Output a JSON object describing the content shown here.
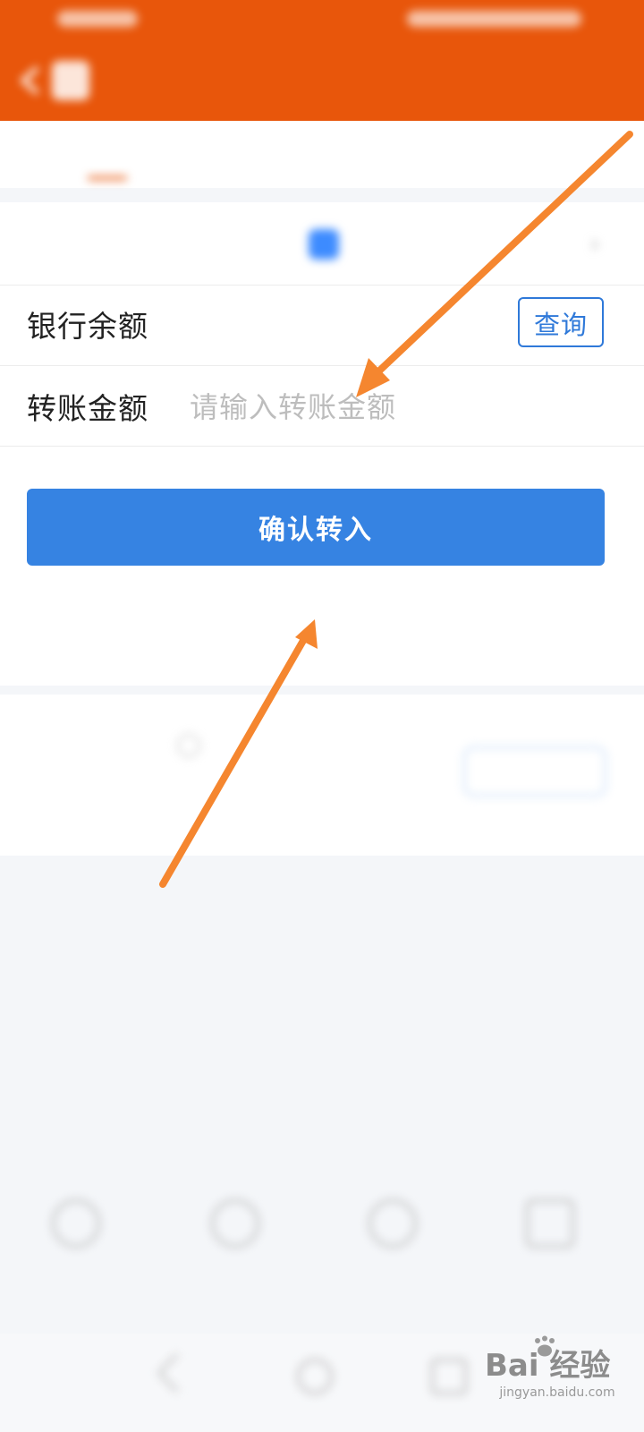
{
  "header": {
    "status_left": "",
    "status_right": "",
    "title": "",
    "subtitle": ""
  },
  "tabs": [
    {
      "label": ""
    },
    {
      "label": ""
    },
    {
      "label": ""
    }
  ],
  "form": {
    "transfer_out_label": "",
    "transfer_out_value": "",
    "balance_label": "银行余额",
    "query_button": "查询",
    "amount_label": "转账金额",
    "amount_placeholder": "请输入转账金额",
    "amount_value": "",
    "confirm_button": "确认转入",
    "transfer_time": "",
    "bank_card_manage": ""
  },
  "account": {
    "title": "",
    "amount": "",
    "button": ""
  },
  "shortcuts": [
    {
      "label": ""
    },
    {
      "label": ""
    },
    {
      "label": ""
    },
    {
      "label": ""
    }
  ],
  "watermark": {
    "logo": "Bai  经验",
    "url": "jingyan.baidu.com"
  },
  "colors": {
    "header": "#e8560b",
    "primary": "#3683e2",
    "arrow": "#f5862f"
  }
}
